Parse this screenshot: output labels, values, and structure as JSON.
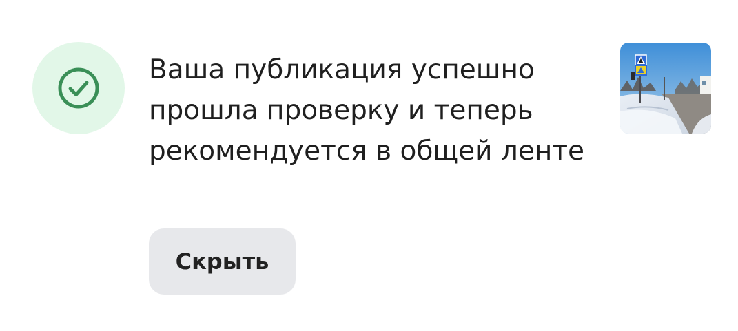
{
  "notification": {
    "status_icon": "check-circle-icon",
    "message": "Ваша публикация успешно прошла проверку и теперь рекомендуется в общей ленте",
    "hide_label": "Скрыть",
    "thumbnail_icon": "snowy-street-photo-thumbnail",
    "colors": {
      "icon_bg": "#e2f7e8",
      "icon_stroke": "#3a8f57",
      "button_bg": "#e7e8eb",
      "text": "#1f1f1f"
    }
  }
}
